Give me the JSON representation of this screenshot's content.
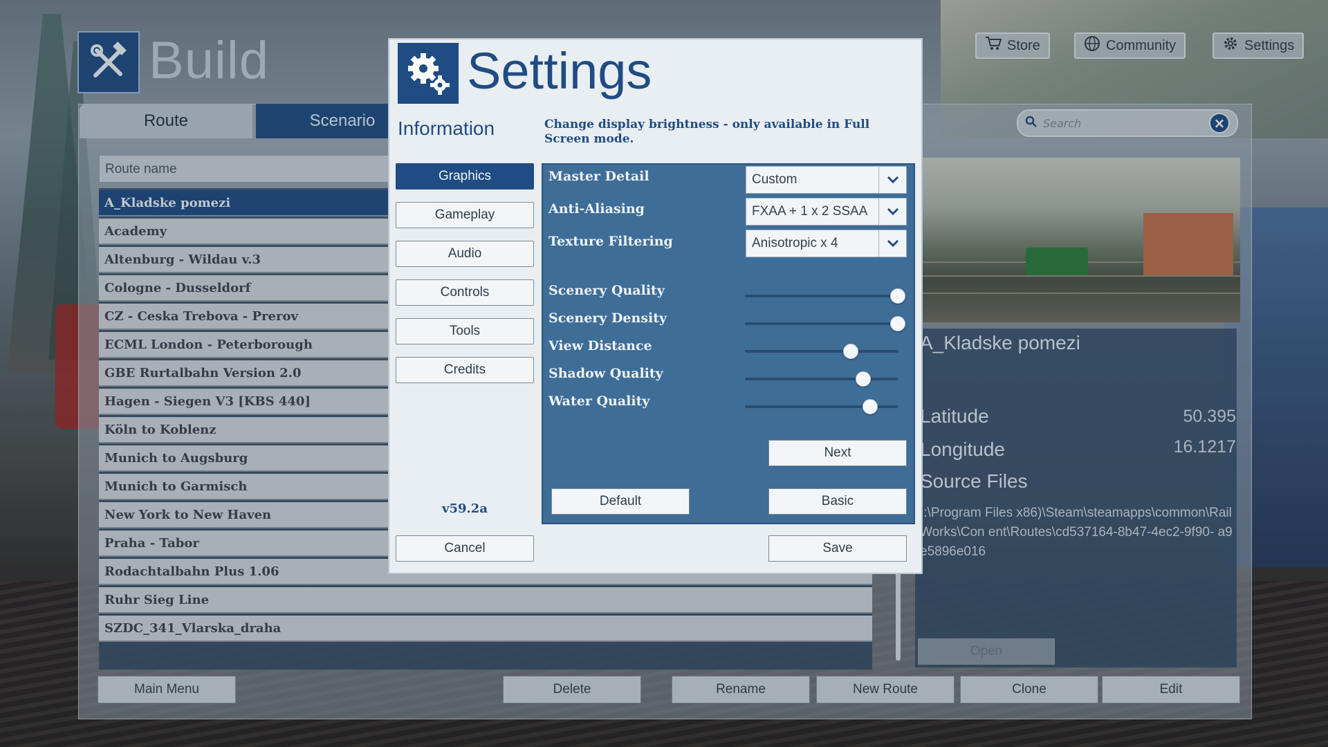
{
  "header": {
    "title": "Build"
  },
  "top_nav": [
    {
      "label": "Store",
      "icon": "cart-icon"
    },
    {
      "label": "Community",
      "icon": "globe-icon"
    },
    {
      "label": "Settings",
      "icon": "gear-icon"
    }
  ],
  "tabs": [
    {
      "label": "Route",
      "active": true
    },
    {
      "label": "Scenario",
      "active": false
    }
  ],
  "route_list": {
    "header": "Route name",
    "items": [
      "A_Kladske pomezi",
      "Academy",
      "Altenburg - Wildau v.3",
      "Cologne - Dusseldorf",
      "CZ - Ceska Trebova - Prerov",
      "ECML London - Peterborough",
      "GBE Rurtalbahn Version 2.0",
      "Hagen - Siegen V3 [KBS 440]",
      "Köln to Koblenz",
      "Munich to Augsburg",
      "Munich to Garmisch",
      "New York to New Haven",
      "Praha - Tabor",
      "Rodachtalbahn Plus 1.06",
      "Ruhr Sieg Line",
      "SZDC_341_Vlarska_draha"
    ],
    "selected_index": 0
  },
  "bottom_buttons": {
    "main_menu": "Main Menu",
    "delete": "Delete",
    "rename": "Rename",
    "new_route": "New Route",
    "clone": "Clone",
    "edit": "Edit"
  },
  "search": {
    "placeholder": "Search"
  },
  "route_info": {
    "title": "A_Kladske pomezi",
    "latitude_label": "Latitude",
    "latitude_value": "50.395",
    "longitude_label": "Longitude",
    "longitude_value": "16.1217",
    "source_label": "Source Files",
    "source_path": "::\\Program Files x86)\\Steam\\steamapps\\common\\RailWorks\\Con ent\\Routes\\cd537164-8b47-4ec2-9f90- a9e5896e016",
    "open_label": "Open"
  },
  "settings": {
    "title": "Settings",
    "section": "Information",
    "description": "Change display brightness - only available in Full Screen mode.",
    "version": "v59.2a",
    "nav": [
      {
        "label": "Graphics",
        "active": true
      },
      {
        "label": "Gameplay",
        "active": false
      },
      {
        "label": "Audio",
        "active": false
      },
      {
        "label": "Controls",
        "active": false
      },
      {
        "label": "Tools",
        "active": false
      },
      {
        "label": "Credits",
        "active": false
      }
    ],
    "selects": [
      {
        "label": "Master Detail",
        "value": "Custom"
      },
      {
        "label": "Anti-Aliasing",
        "value": "FXAA + 1 x 2 SSAA"
      },
      {
        "label": "Texture Filtering",
        "value": "Anisotropic x 4"
      }
    ],
    "sliders": [
      {
        "label": "Scenery Quality",
        "level": 1.0
      },
      {
        "label": "Scenery Density",
        "level": 1.0
      },
      {
        "label": "View Distance",
        "level": 0.66
      },
      {
        "label": "Shadow Quality",
        "level": 0.75
      },
      {
        "label": "Water Quality",
        "level": 0.8
      }
    ],
    "buttons": {
      "next": "Next",
      "default": "Default",
      "basic": "Basic",
      "cancel": "Cancel",
      "save": "Save"
    }
  },
  "colors": {
    "accent": "#1f4c82",
    "panel": "#3e6d98",
    "dialog_bg": "#e9eef2"
  }
}
